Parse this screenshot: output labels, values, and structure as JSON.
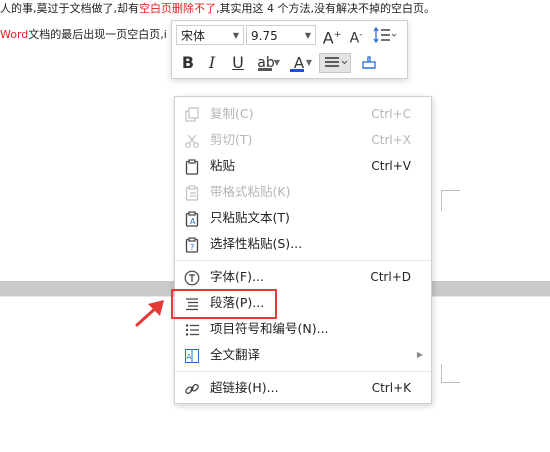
{
  "document": {
    "line1": {
      "a": "人的事,莫过于文档做了,却有",
      "b": "空白页删除不了",
      "c": ",其实用这 4 个方法,没有解决不掉的空白页。"
    },
    "line2": {
      "a": "Word",
      "b": "文档的最后出现一页空白页,",
      "c": "i"
    }
  },
  "toolbar": {
    "font_name": "宋体",
    "font_size": "9.75",
    "grow_font": "A",
    "shrink_font": "A",
    "bold": "B",
    "italic": "I",
    "underline": "U",
    "highlight": "ab",
    "font_color": "A"
  },
  "menu": {
    "items": [
      {
        "label": "复制(C)",
        "shortcut": "Ctrl+C",
        "icon": "copy-icon",
        "enabled": false
      },
      {
        "label": "剪切(T)",
        "shortcut": "Ctrl+X",
        "icon": "scissors-icon",
        "enabled": false
      },
      {
        "label": "粘贴",
        "shortcut": "Ctrl+V",
        "icon": "clipboard-icon",
        "enabled": true
      },
      {
        "label": "带格式粘贴(K)",
        "shortcut": "",
        "icon": "paste-format-icon",
        "enabled": false
      },
      {
        "label": "只粘贴文本(T)",
        "shortcut": "",
        "icon": "paste-text-icon",
        "enabled": true
      },
      {
        "label": "选择性粘贴(S)...",
        "shortcut": "",
        "icon": "paste-special-icon",
        "enabled": true
      },
      {
        "label": "字体(F)...",
        "shortcut": "Ctrl+D",
        "icon": "font-icon",
        "enabled": true
      },
      {
        "label": "段落(P)...",
        "shortcut": "",
        "icon": "paragraph-icon",
        "enabled": true
      },
      {
        "label": "项目符号和编号(N)...",
        "shortcut": "",
        "icon": "bullets-icon",
        "enabled": true
      },
      {
        "label": "全文翻译",
        "shortcut": "",
        "icon": "translate-icon",
        "enabled": true
      },
      {
        "label": "超链接(H)...",
        "shortcut": "Ctrl+K",
        "icon": "link-icon",
        "enabled": true
      }
    ]
  },
  "colors": {
    "accent_red": "#e53935",
    "font_color_blue": "#1a4fd6"
  }
}
